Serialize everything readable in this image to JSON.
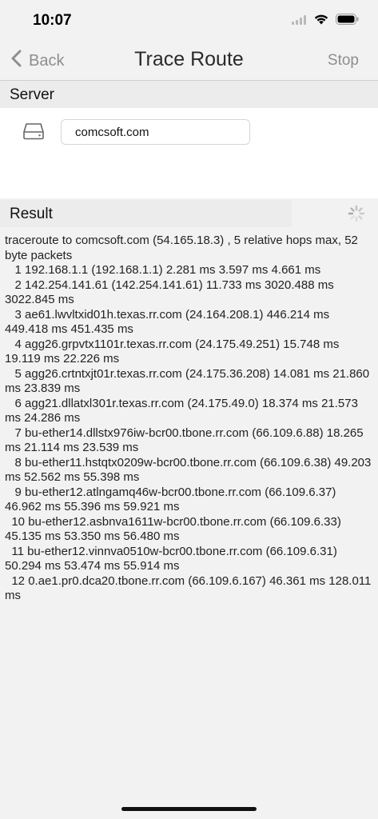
{
  "status_bar": {
    "time": "10:07"
  },
  "nav": {
    "back_label": "Back",
    "title": "Trace Route",
    "stop_label": "Stop"
  },
  "server": {
    "section_title": "Server",
    "host_value": "comcsoft.com",
    "icon": "drive-icon"
  },
  "result": {
    "section_title": "Result",
    "icon": "spinner-icon",
    "text": "traceroute to comcsoft.com (54.165.18.3) , 5 relative hops max, 52 byte packets\n   1 192.168.1.1 (192.168.1.1) 2.281 ms 3.597 ms 4.661 ms\n   2 142.254.141.61 (142.254.141.61) 11.733 ms 3020.488 ms 3022.845 ms\n   3 ae61.lwvltxid01h.texas.rr.com (24.164.208.1) 446.214 ms 449.418 ms 451.435 ms\n   4 agg26.grpvtx1101r.texas.rr.com (24.175.49.251) 15.748 ms 19.119 ms 22.226 ms\n   5 agg26.crtntxjt01r.texas.rr.com (24.175.36.208) 14.081 ms 21.860 ms 23.839 ms\n   6 agg21.dllatxl301r.texas.rr.com (24.175.49.0) 18.374 ms 21.573 ms 24.286 ms\n   7 bu-ether14.dllstx976iw-bcr00.tbone.rr.com (66.109.6.88) 18.265 ms 21.114 ms 23.539 ms\n   8 bu-ether11.hstqtx0209w-bcr00.tbone.rr.com (66.109.6.38) 49.203 ms 52.562 ms 55.398 ms\n   9 bu-ether12.atlngamq46w-bcr00.tbone.rr.com (66.109.6.37) 46.962 ms 55.396 ms 59.921 ms\n  10 bu-ether12.asbnva1611w-bcr00.tbone.rr.com (66.109.6.33) 45.135 ms 53.350 ms 56.480 ms\n  11 bu-ether12.vinnva0510w-bcr00.tbone.rr.com (66.109.6.31) 50.294 ms 53.474 ms 55.914 ms\n  12 0.ae1.pr0.dca20.tbone.rr.com (66.109.6.167) 46.361 ms 128.011 ms"
  },
  "colors": {
    "background": "#f2f2f2",
    "nav_inactive": "#8e8e8e",
    "panel": "#ffffff",
    "text": "#222222"
  }
}
